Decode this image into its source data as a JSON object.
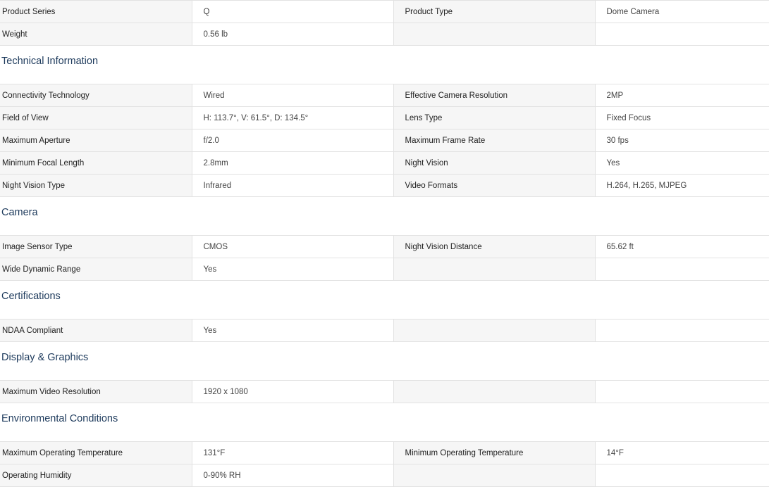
{
  "top_rows": [
    [
      "Product Series",
      "Q",
      "Product Type",
      "Dome Camera"
    ],
    [
      "Weight",
      "0.56 lb",
      "",
      ""
    ]
  ],
  "sections": [
    {
      "title": "Technical Information",
      "rows": [
        [
          "Connectivity Technology",
          "Wired",
          "Effective Camera Resolution",
          "2MP"
        ],
        [
          "Field of View",
          "H: 113.7°, V: 61.5°, D: 134.5°",
          "Lens Type",
          "Fixed Focus"
        ],
        [
          "Maximum Aperture",
          "f/2.0",
          "Maximum Frame Rate",
          "30 fps"
        ],
        [
          "Minimum Focal Length",
          "2.8mm",
          "Night Vision",
          "Yes"
        ],
        [
          "Night Vision Type",
          "Infrared",
          "Video Formats",
          "H.264, H.265, MJPEG"
        ]
      ]
    },
    {
      "title": "Camera",
      "rows": [
        [
          "Image Sensor Type",
          "CMOS",
          "Night Vision Distance",
          "65.62 ft"
        ],
        [
          "Wide Dynamic Range",
          "Yes",
          "",
          ""
        ]
      ]
    },
    {
      "title": "Certifications",
      "rows": [
        [
          "NDAA Compliant",
          "Yes",
          "",
          ""
        ]
      ]
    },
    {
      "title": "Display & Graphics",
      "rows": [
        [
          "Maximum Video Resolution",
          "1920 x 1080",
          "",
          ""
        ]
      ]
    },
    {
      "title": "Environmental Conditions",
      "rows": [
        [
          "Maximum Operating Temperature",
          "131°F",
          "Minimum Operating Temperature",
          "14°F"
        ],
        [
          "Operating Humidity",
          "0-90% RH",
          "",
          ""
        ]
      ]
    }
  ]
}
